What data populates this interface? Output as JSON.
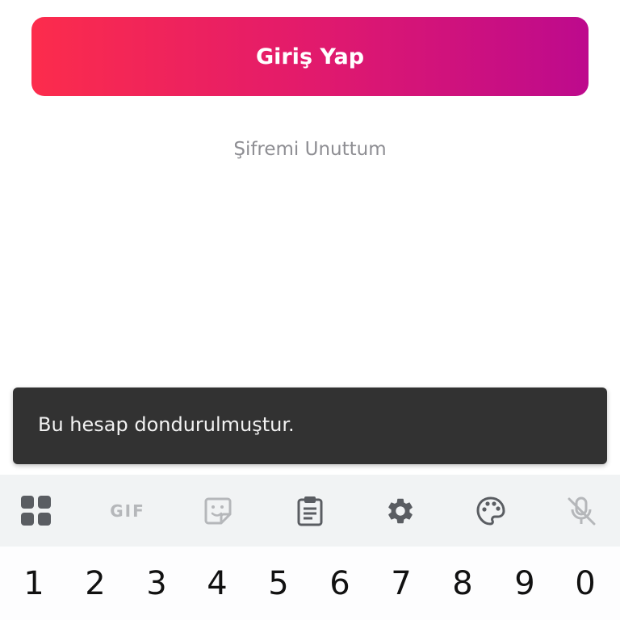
{
  "login": {
    "button_label": "Giriş Yap",
    "forgot_password": "Şifremi Unuttum",
    "gradient_start": "#fc2c4c",
    "gradient_end": "#bd0a8d"
  },
  "snackbar": {
    "message": "Bu hesap dondurulmuştur."
  },
  "keyboard": {
    "toolbar": [
      {
        "icon": "apps-grid-icon"
      },
      {
        "icon": "gif-icon",
        "label": "GIF"
      },
      {
        "icon": "sticker-icon"
      },
      {
        "icon": "clipboard-icon"
      },
      {
        "icon": "settings-icon"
      },
      {
        "icon": "palette-icon"
      },
      {
        "icon": "mic-off-icon"
      }
    ],
    "numbers": [
      "1",
      "2",
      "3",
      "4",
      "5",
      "6",
      "7",
      "8",
      "9",
      "0"
    ]
  }
}
